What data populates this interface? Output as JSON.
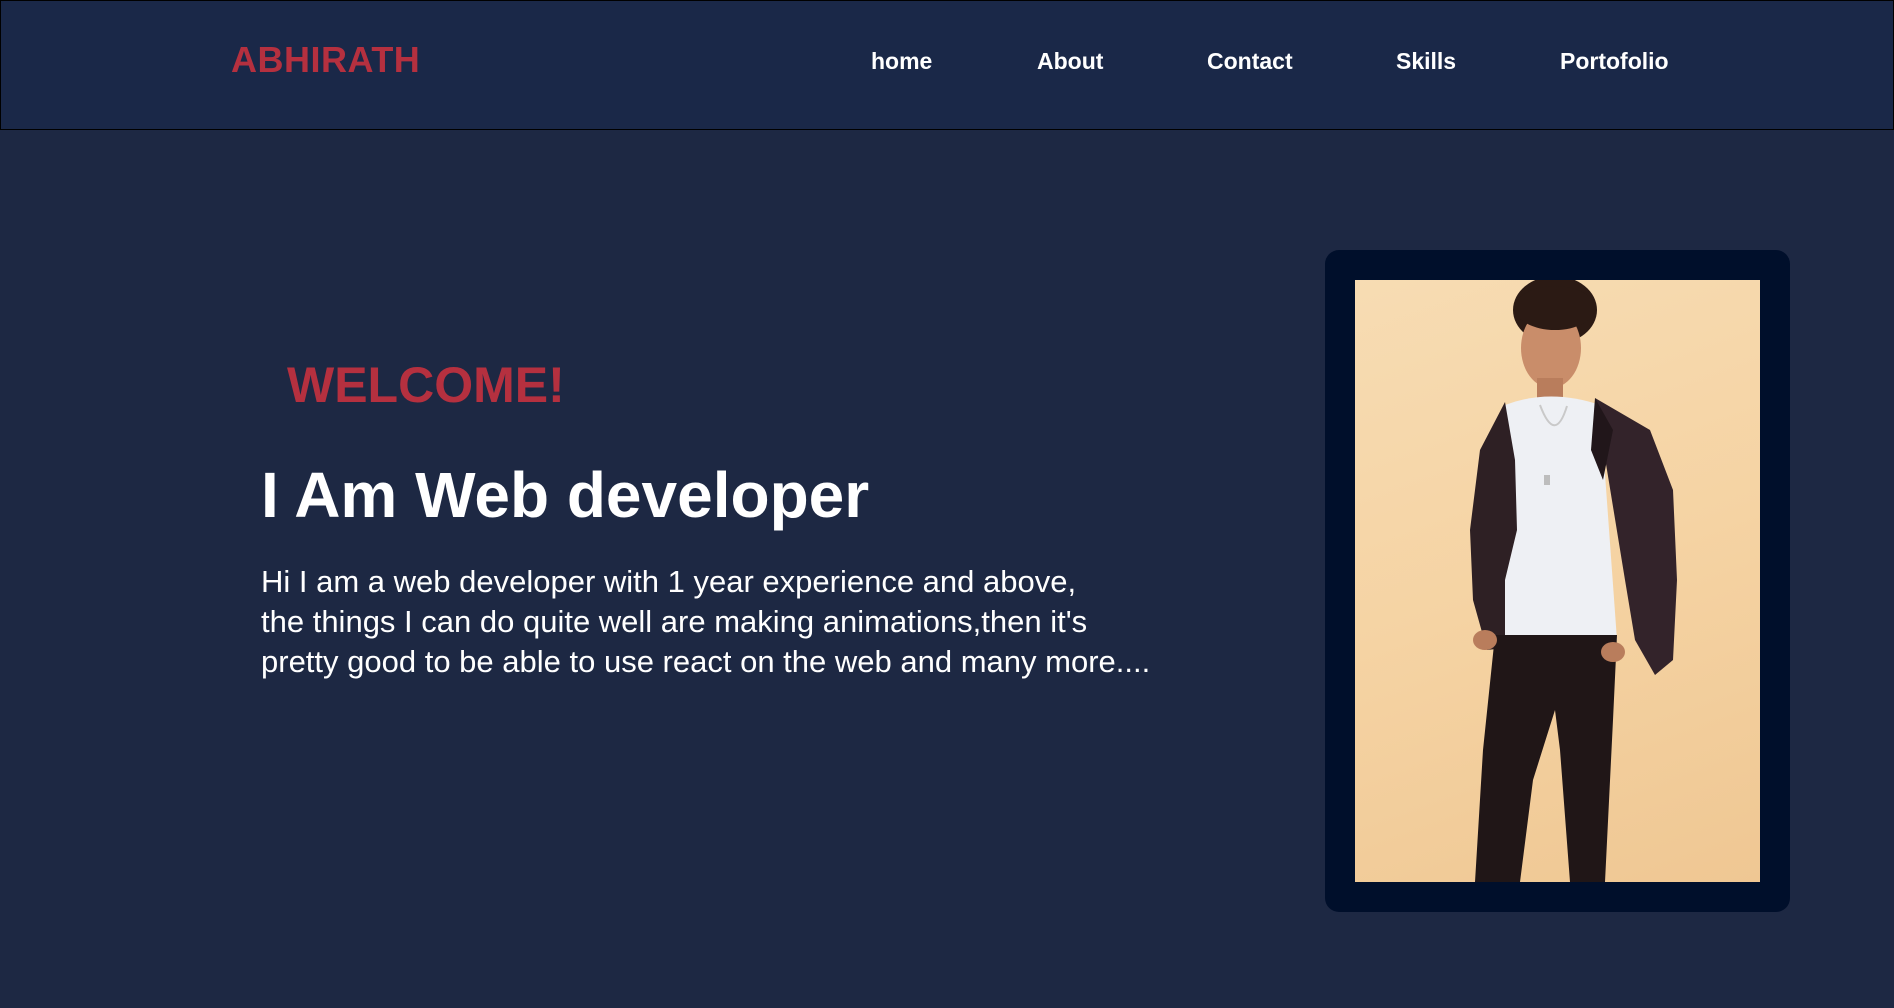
{
  "header": {
    "logo": "ABHIRATH",
    "nav": [
      {
        "label": "home"
      },
      {
        "label": "About"
      },
      {
        "label": "Contact"
      },
      {
        "label": "Skills"
      },
      {
        "label": "Portofolio"
      }
    ]
  },
  "hero": {
    "welcome": "WELCOME!",
    "headline": "I Am Web developer",
    "intro_lines": [
      "Hi I am a web developer with 1 year experience and above,",
      "the things I can do quite well are making animations,then it's",
      "pretty good to be able to use react on the web and many more...."
    ]
  },
  "colors": {
    "background": "#1d2843",
    "navbar": "#1a2848",
    "accent": "#b5303f",
    "frame": "#000f2b"
  }
}
